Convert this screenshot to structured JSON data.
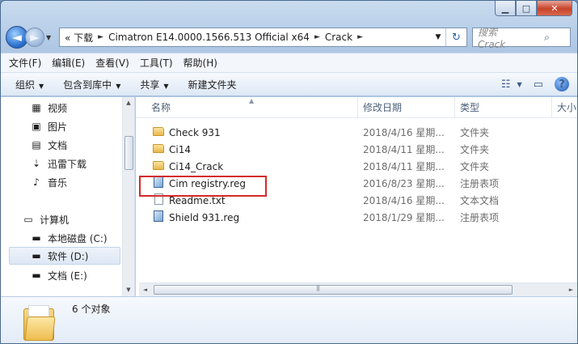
{
  "window": {
    "caption": {
      "minimize": "▁",
      "maximize": "□",
      "close": "✕"
    }
  },
  "address": {
    "back_glyph": "◄",
    "forward_glyph": "►",
    "segments": [
      "« 下载",
      "Cimatron E14.0000.1566.513 Official x64",
      "Crack"
    ],
    "separator": "►",
    "dropdown_glyph": "▼",
    "refresh_glyph": "↻"
  },
  "search": {
    "placeholder": "搜索 Crack",
    "icon_glyph": "⌕"
  },
  "menu": {
    "items": [
      "文件(F)",
      "编辑(E)",
      "查看(V)",
      "工具(T)",
      "帮助(H)"
    ]
  },
  "commands": {
    "items": [
      {
        "label": "组织",
        "dropdown": "▼"
      },
      {
        "label": "包含到库中",
        "dropdown": "▼"
      },
      {
        "label": "共享",
        "dropdown": "▼"
      },
      {
        "label": "新建文件夹",
        "dropdown": ""
      }
    ],
    "view_glyph": "☷",
    "view_dropdown": "▼",
    "preview_glyph": "▭",
    "help_glyph": "?"
  },
  "nav": {
    "items": [
      {
        "label": "视频",
        "icon": "video-icon",
        "glyph": "▦"
      },
      {
        "label": "图片",
        "icon": "picture-icon",
        "glyph": "▣"
      },
      {
        "label": "文档",
        "icon": "document-icon",
        "glyph": "▤"
      },
      {
        "label": "迅雷下载",
        "icon": "thunder-download-icon",
        "glyph": "⇣"
      },
      {
        "label": "音乐",
        "icon": "music-icon",
        "glyph": "♪"
      },
      {
        "label": "计算机",
        "icon": "computer-icon",
        "glyph": "▭"
      },
      {
        "label": "本地磁盘 (C:)",
        "icon": "local-disk-icon",
        "glyph": "▬"
      },
      {
        "label": "软件 (D:)",
        "icon": "drive-icon",
        "glyph": "▬"
      },
      {
        "label": "文档 (E:)",
        "icon": "drive-icon",
        "glyph": "▬"
      }
    ],
    "selected_index": 7
  },
  "columns": [
    "名称",
    "修改日期",
    "类型",
    "大小"
  ],
  "sort_glyph": "▲",
  "files": [
    {
      "name": "Check 931",
      "date": "2018/4/16 星期...",
      "type": "文件夹",
      "kind": "folder"
    },
    {
      "name": "Ci14",
      "date": "2018/4/11 星期...",
      "type": "文件夹",
      "kind": "folder"
    },
    {
      "name": "Ci14_Crack",
      "date": "2018/4/11 星期...",
      "type": "文件夹",
      "kind": "folder"
    },
    {
      "name": "Cim registry.reg",
      "date": "2016/8/23 星期...",
      "type": "注册表项",
      "kind": "reg"
    },
    {
      "name": "Readme.txt",
      "date": "2018/4/16 星期...",
      "type": "文本文档",
      "kind": "txt"
    },
    {
      "name": "Shield 931.reg",
      "date": "2018/1/29 星期...",
      "type": "注册表项",
      "kind": "reg"
    }
  ],
  "highlighted_file_index": 3,
  "details": {
    "count": "6 个对象"
  },
  "scroll_glyphs": {
    "up": "▲",
    "down": "▼",
    "left": "◄",
    "right": "►",
    "grip": "|||"
  },
  "colors": {
    "highlight_border": "#d42b2b",
    "accent": "#2a6fcf"
  }
}
